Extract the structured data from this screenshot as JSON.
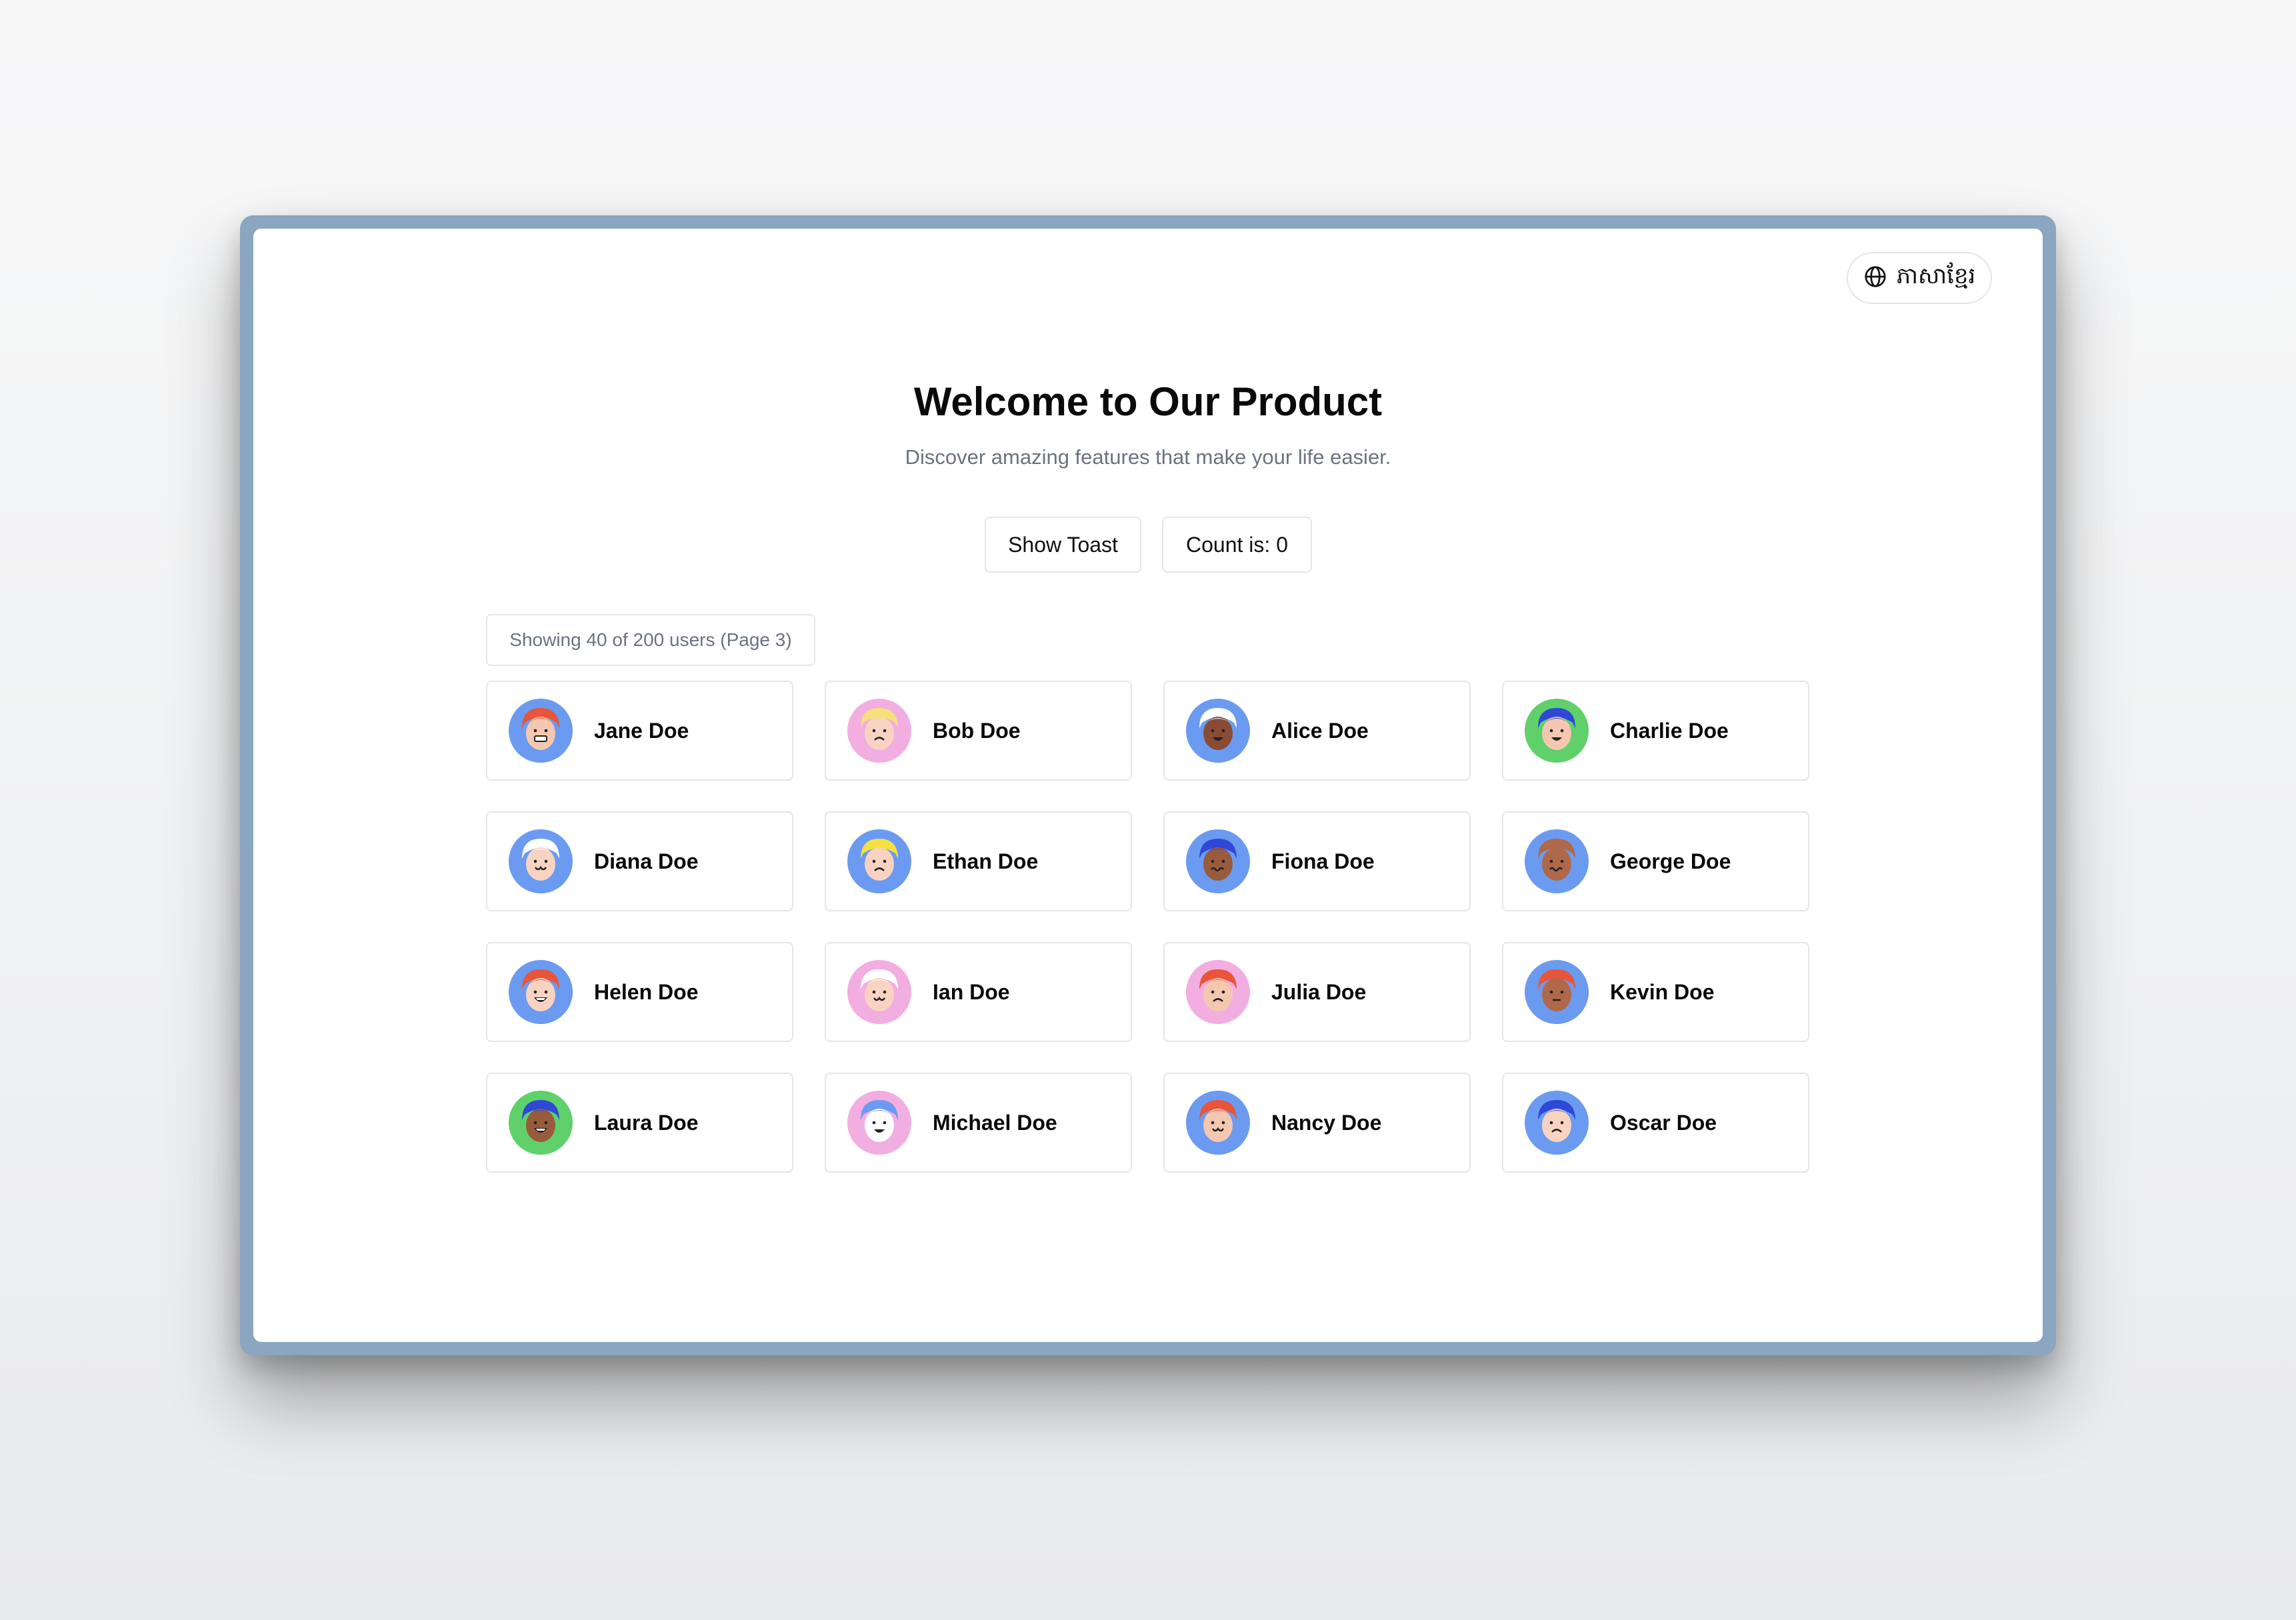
{
  "language_switcher": {
    "label": "ភាសាខ្មែរ",
    "icon": "globe-icon"
  },
  "hero": {
    "title": "Welcome to Our Product",
    "subtitle": "Discover amazing features that make your life easier."
  },
  "actions": {
    "show_toast_label": "Show Toast",
    "count_label": "Count is: 0"
  },
  "users_status": "Showing 40 of 200 users (Page 3)",
  "users": [
    {
      "name": "Jane Doe",
      "bg": "#6b9bf0",
      "skin": "#f4c7b0",
      "hair": "#e8553a",
      "mouth": "grimace"
    },
    {
      "name": "Bob Doe",
      "bg": "#f2aee0",
      "skin": "#f9d3c2",
      "hair": "#f6e07a",
      "mouth": "frown"
    },
    {
      "name": "Alice Doe",
      "bg": "#6b9bf0",
      "skin": "#8a4b35",
      "hair": "#ffffff",
      "mouth": "smile"
    },
    {
      "name": "Charlie Doe",
      "bg": "#5fd06a",
      "skin": "#f4c7b0",
      "hair": "#2f48d6",
      "mouth": "smile"
    },
    {
      "name": "Diana Doe",
      "bg": "#6b9bf0",
      "skin": "#f9d3c2",
      "hair": "#ffffff",
      "mouth": "w"
    },
    {
      "name": "Ethan Doe",
      "bg": "#6b9bf0",
      "skin": "#f9d3c2",
      "hair": "#f5e042",
      "mouth": "frown"
    },
    {
      "name": "Fiona Doe",
      "bg": "#6b9bf0",
      "skin": "#9a5a3c",
      "hair": "#2f48d6",
      "mouth": "wavy"
    },
    {
      "name": "George Doe",
      "bg": "#6b9bf0",
      "skin": "#b0684a",
      "hair": "#b0684a",
      "mouth": "wavy"
    },
    {
      "name": "Helen Doe",
      "bg": "#6b9bf0",
      "skin": "#f9d3c2",
      "hair": "#e8553a",
      "mouth": "grin"
    },
    {
      "name": "Ian Doe",
      "bg": "#f2aee0",
      "skin": "#f9d3c2",
      "hair": "#ffffff",
      "mouth": "w"
    },
    {
      "name": "Julia Doe",
      "bg": "#f2aee0",
      "skin": "#f4c7b0",
      "hair": "#e8553a",
      "mouth": "frown"
    },
    {
      "name": "Kevin Doe",
      "bg": "#6b9bf0",
      "skin": "#b0684a",
      "hair": "#e8553a",
      "mouth": "flat"
    },
    {
      "name": "Laura Doe",
      "bg": "#5fd06a",
      "skin": "#9a5a3c",
      "hair": "#2f48d6",
      "mouth": "grin"
    },
    {
      "name": "Michael Doe",
      "bg": "#f2aee0",
      "skin": "#ffffff",
      "hair": "#6b9bf0",
      "mouth": "smile"
    },
    {
      "name": "Nancy Doe",
      "bg": "#6b9bf0",
      "skin": "#f4c7b0",
      "hair": "#e8553a",
      "mouth": "w"
    },
    {
      "name": "Oscar Doe",
      "bg": "#6b9bf0",
      "skin": "#f9d3c2",
      "hair": "#2f48d6",
      "mouth": "frown"
    }
  ]
}
